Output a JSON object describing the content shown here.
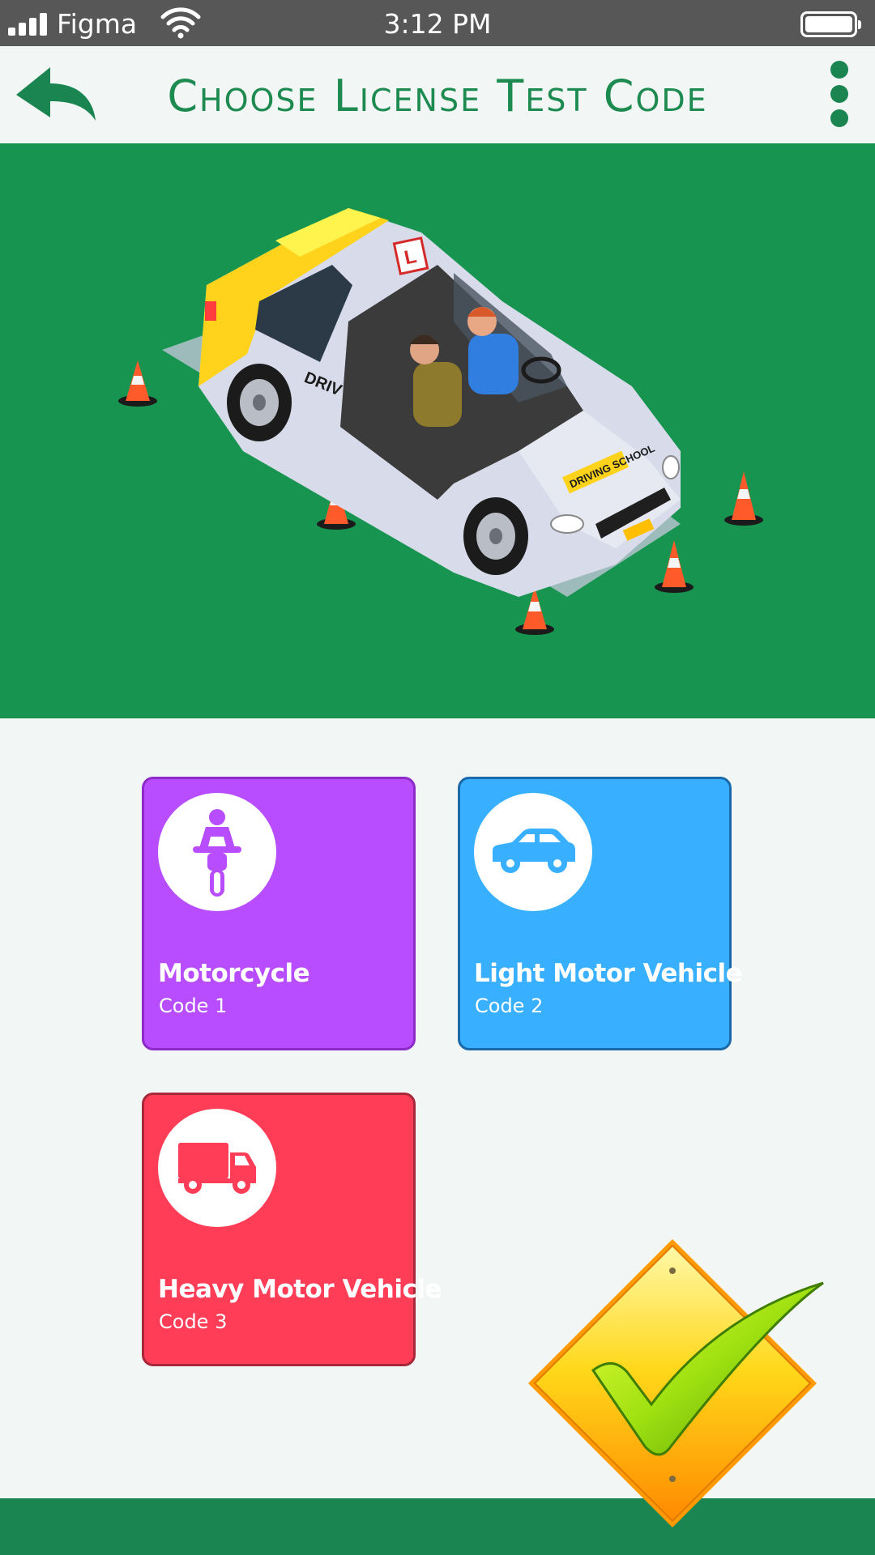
{
  "status_bar": {
    "carrier": "Figma",
    "time": "3:12 PM"
  },
  "header": {
    "title": "Choose License Test Code"
  },
  "hero": {
    "car_side_text": "DRIV",
    "hood_text": "DRIVING SCHOOL",
    "sign_letter": "L"
  },
  "tiles": [
    {
      "name": "Motorcycle",
      "code": "Code 1",
      "icon": "motorcycle-icon",
      "color": "#b84dff"
    },
    {
      "name": "Light Motor Vehicle",
      "code": "Code 2",
      "icon": "car-icon",
      "color": "#38afff"
    },
    {
      "name": "Heavy Motor Vehicle",
      "code": "Code 3",
      "icon": "truck-icon",
      "color": "#ff3d57"
    }
  ],
  "colors": {
    "accent": "#1a8550",
    "hero_bg": "#179450",
    "page_bg": "#f2f7f5",
    "status_bar": "#575757"
  },
  "icons": {
    "back": "back-arrow-icon",
    "menu": "more-vertical-icon",
    "confirm": "checkmark-sign-icon"
  }
}
